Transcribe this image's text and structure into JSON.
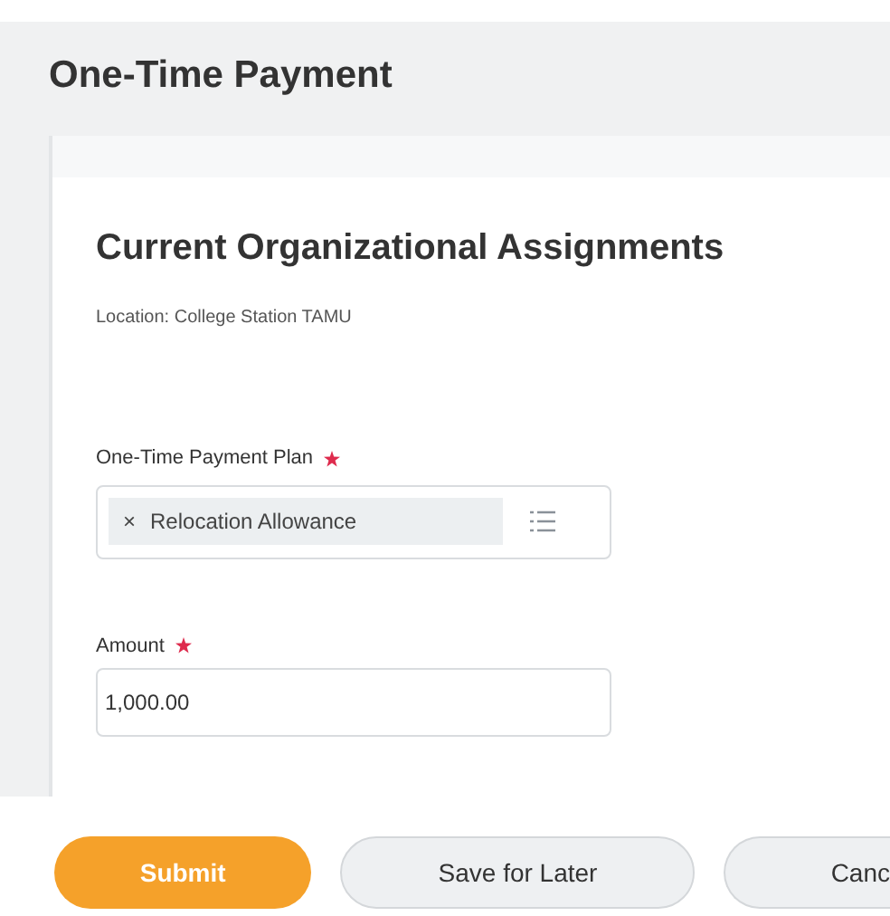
{
  "page": {
    "title": "One-Time Payment"
  },
  "section": {
    "title": "Current Organizational Assignments",
    "location": "Location: College Station TAMU"
  },
  "fields": [
    {
      "kind": "select",
      "label": "One-Time Payment Plan",
      "required": true,
      "remove": "×",
      "value": "Relocation Allowance"
    },
    {
      "kind": "text",
      "label": "Amount",
      "required": true,
      "value": "1,000.00"
    }
  ],
  "buttons": [
    {
      "kind": "primary",
      "label": "Submit"
    },
    {
      "kind": "secondary",
      "label": "Save for Later"
    },
    {
      "kind": "cut",
      "label": "Canc"
    }
  ]
}
